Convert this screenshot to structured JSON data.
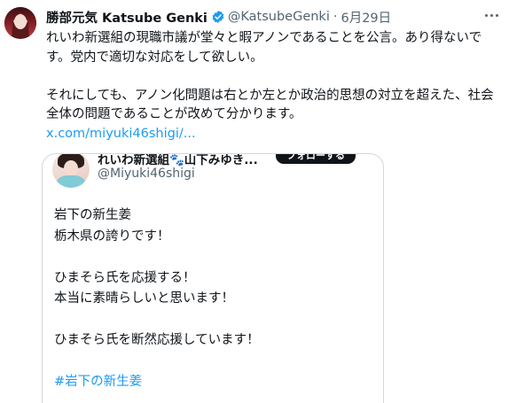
{
  "tweet": {
    "display_name": "勝部元気 Katsube Genki",
    "handle": "@KatsubeGenki",
    "separator": "·",
    "date": "6月29日",
    "body": {
      "paragraph1": "れいわ新選組の現職市議が堂々と暇アノンであることを公言。あり得ないです。党内で適切な対応をして欲しい。",
      "paragraph2": "それにしても、アノン化問題は右とか左とか政治的思想の対立を超えた、社会全体の問題であることが改めて分かります。",
      "link_text": "x.com/miyuki46shigi/..."
    },
    "colors": {
      "link": "#1d9bf0",
      "verified": "#1d9bf0",
      "secondary_text": "#536471"
    }
  },
  "quoted_tweet": {
    "name_truncated": "れいわ新選組🐾山下みゆき...",
    "follow_label": "フォローする",
    "handle": "@Miyuki46shigi",
    "lines": {
      "line1": "岩下の新生姜",
      "line2": "栃木県の誇りです！",
      "line3": "ひまそら氏を応援する！",
      "line4": "本当に素晴らしいと思います！",
      "line5": "ひまそら氏を断然応援しています！",
      "hashtag": "#岩下の新生姜"
    }
  },
  "icons": {
    "verified": "verified-badge-icon",
    "more": "more-options-icon"
  }
}
